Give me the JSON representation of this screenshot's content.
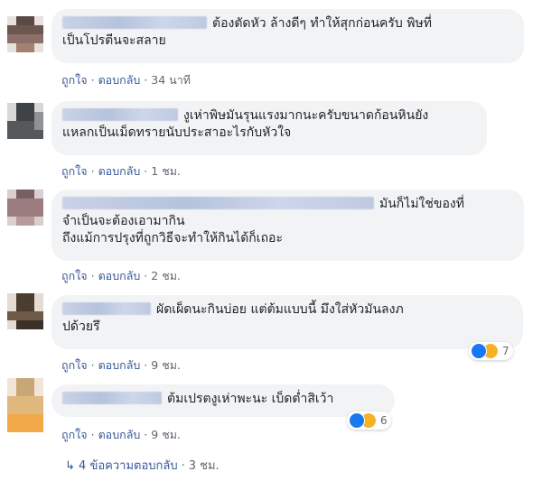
{
  "comments": [
    {
      "lines": [
        "ต้องตัดหัว ล้างดีๆ ทำให้สุกก่อนครับ พิษที่",
        "เป็นโปรตีนจะสลาย"
      ],
      "like": "ถูกใจ",
      "reply": "ตอบกลับ",
      "time": "34 นาที"
    },
    {
      "lines": [
        "งูเห่าพิษมันรุนแรงมากนะครับขนาดก้อนหินยัง",
        "แหลกเป็นเม็ดทรายนับประสาอะไรกับหัวใจ"
      ],
      "like": "ถูกใจ",
      "reply": "ตอบกลับ",
      "time": "1 ชม."
    },
    {
      "lines": [
        "มันก็ไม่ใช่ของที่",
        "จำเป็นจะต้องเอามากิน",
        "ถึงแม้การปรุงที่ถูกวิธีจะทำให้กินได้ก็เถอะ"
      ],
      "like": "ถูกใจ",
      "reply": "ตอบกลับ",
      "time": "2 ชม."
    },
    {
      "lines": [
        "ผัดเผ็ดนะกินบ่อย แต่ต้มแบบนี้ มึงใส่หัวมันลงภ",
        "ปด้วยรึ"
      ],
      "like": "ถูกใจ",
      "reply": "ตอบกลับ",
      "time": "9 ชม.",
      "reaction_count": "7"
    },
    {
      "lines": [
        "ต้มเปรตงูเห่าพะนะ เบ็ดต่ำสิเว้า"
      ],
      "like": "ถูกใจ",
      "reply": "ตอบกลับ",
      "time": "9 ชม.",
      "reaction_count": "6"
    }
  ],
  "dot": "·",
  "replies_link": {
    "arrow": "↳",
    "label": "4 ข้อความตอบกลับ",
    "time": "3 ชม."
  },
  "colors": {
    "bubble": "#f2f3f5",
    "link": "#385898",
    "meta": "#606770",
    "like": "#1877f2",
    "haha": "#f7b125"
  }
}
